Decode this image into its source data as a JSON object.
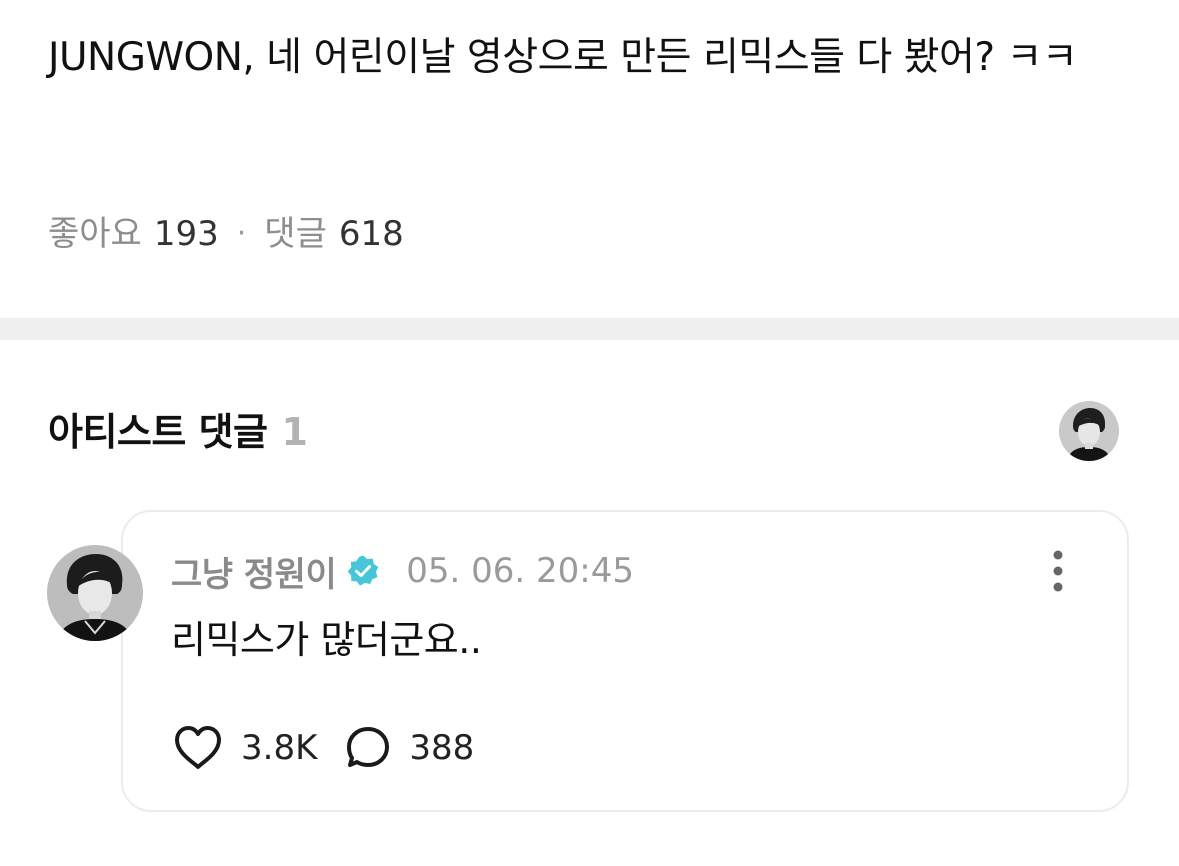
{
  "post": {
    "text": "JUNGWON, 네 어린이날 영상으로 만든 리믹스들 다 봤어? ㅋㅋ",
    "likes_label": "좋아요",
    "likes_count": "193",
    "separator": "·",
    "comments_label": "댓글",
    "comments_count": "618"
  },
  "artist_section": {
    "title": "아티스트 댓글",
    "count": "1",
    "avatar_icon": "profile-avatar"
  },
  "comment": {
    "author": "그냥 정원이",
    "verified_icon": "verified-badge-icon",
    "verified_color": "#47c6d7",
    "timestamp": "05. 06. 20:45",
    "body": "리믹스가 많더군요..",
    "likes": "3.8K",
    "replies": "388",
    "like_icon": "heart-icon",
    "reply_icon": "speech-bubble-icon",
    "more_icon": "more-vertical-icon"
  }
}
